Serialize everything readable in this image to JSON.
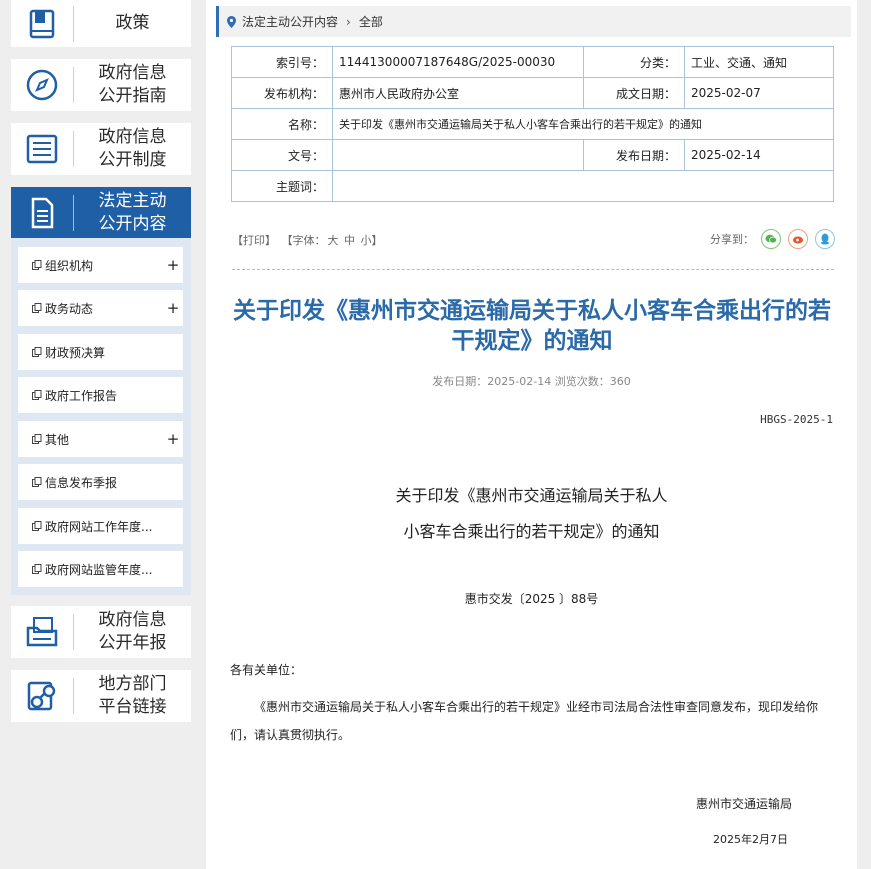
{
  "sidebar": {
    "nav": [
      {
        "label": "政策"
      },
      {
        "label": "政府信息\n公开指南"
      },
      {
        "label": "政府信息\n公开制度"
      },
      {
        "label": "法定主动\n公开内容"
      },
      {
        "label": "政府信息\n公开年报"
      },
      {
        "label": "地方部门\n平台链接"
      }
    ],
    "subitems": [
      {
        "label": "组织机构",
        "plus": "+"
      },
      {
        "label": "政务动态",
        "plus": "+"
      },
      {
        "label": "财政预决算",
        "plus": ""
      },
      {
        "label": "政府工作报告",
        "plus": ""
      },
      {
        "label": "其他",
        "plus": "+"
      },
      {
        "label": "信息发布季报",
        "plus": ""
      },
      {
        "label": "政府网站工作年度...",
        "plus": ""
      },
      {
        "label": "政府网站监管年度...",
        "plus": ""
      }
    ]
  },
  "breadcrumb": {
    "item1": "法定主动公开内容",
    "item2": "全部"
  },
  "meta": {
    "index_label": "索引号：",
    "index_value": "11441300007187648G/2025-00030",
    "category_label": "分类：",
    "category_value": "工业、交通、通知",
    "org_label": "发布机构：",
    "org_value": "惠州市人民政府办公室",
    "created_label": "成文日期：",
    "created_value": "2025-02-07",
    "name_label": "名称：",
    "name_value": "关于印发《惠州市交通运输局关于私人小客车合乘出行的若干规定》的通知",
    "docno_label": "文号：",
    "docno_value": "",
    "pubdate_label": "发布日期：",
    "pubdate_value": "2025-02-14",
    "subject_label": "主题词：",
    "subject_value": ""
  },
  "tools": {
    "print": "【打印】",
    "font": "【字体：",
    "font_big": "大",
    "font_mid": "中",
    "font_small": "小】"
  },
  "share": {
    "label": "分享到：",
    "icons": [
      "wechat-icon",
      "weibo-icon",
      "qq-icon"
    ]
  },
  "article": {
    "title": "关于印发《惠州市交通运输局关于私人小客车合乘出行的若干规定》的通知",
    "pubinfo": "发布日期：2025-02-14  浏览次数：360",
    "code": "HBGS-2025-1",
    "subtitle_line1": "关于印发《惠州市交通运输局关于私人",
    "subtitle_line2": "小客车合乘出行的若干规定》的通知",
    "docno": "惠市交发〔2025 〕88号",
    "addressee": "各有关单位：",
    "body": "《惠州市交通运输局关于私人小客车合乘出行的若干规定》业经市司法局合法性审查同意发布，现印发给你们，请认真贯彻执行。",
    "signature": "惠州市交通运输局",
    "date": "2025年2月7日"
  },
  "colors": {
    "accent": "#1f5fa6",
    "title": "#2b6aa8",
    "border": "#a9c3dd"
  }
}
